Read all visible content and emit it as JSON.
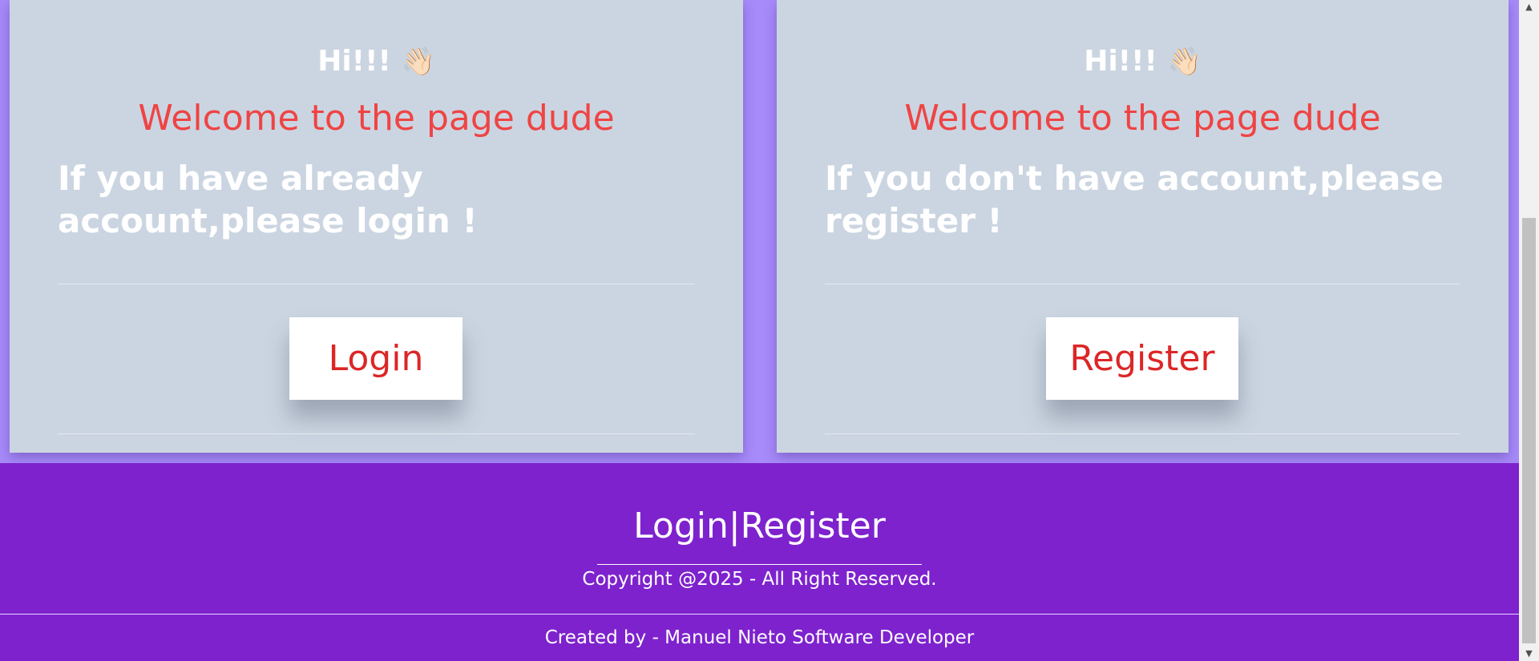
{
  "login_card": {
    "greeting": "Hi!!!",
    "wave_emoji": "👋🏻",
    "welcome": "Welcome to the page dude",
    "message": "If you have already account,please login !",
    "button_label": "Login"
  },
  "register_card": {
    "greeting": "Hi!!!",
    "wave_emoji": "👋🏻",
    "welcome": "Welcome to the page dude",
    "message": "If you don't have account,please register !",
    "button_label": "Register"
  },
  "footer": {
    "brand": "Login|Register",
    "copyright": "Copyright @2025 - All Right Reserved.",
    "credit": "Created by - Manuel Nieto Software Developer"
  },
  "scrollbar": {
    "up_icon": "▲",
    "down_icon": "▼"
  },
  "colors": {
    "page_background": "#a78bfa",
    "card_background": "#cbd5e1",
    "welcome_text": "#ef4444",
    "button_text": "#dc2626",
    "footer_background": "#7e22ce"
  }
}
